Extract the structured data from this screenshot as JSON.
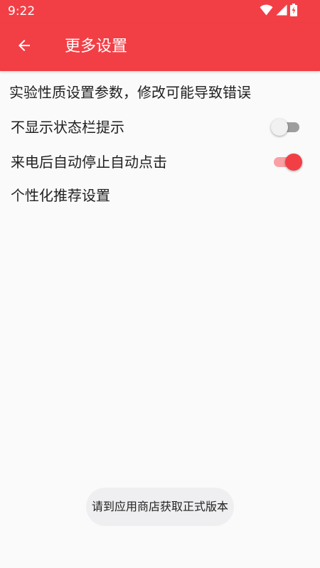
{
  "status_bar": {
    "time": "9:22",
    "icons": [
      "wifi-icon",
      "signal-icon",
      "battery-charging-icon"
    ]
  },
  "app_bar": {
    "title": "更多设置",
    "back_icon": "arrow-back-icon"
  },
  "warning": "实验性质设置参数，修改可能导致错误",
  "settings": [
    {
      "label": "不显示状态栏提示",
      "type": "switch",
      "checked": false
    },
    {
      "label": "来电后自动停止自动点击",
      "type": "switch",
      "checked": true
    },
    {
      "label": "个性化推荐设置",
      "type": "link"
    }
  ],
  "toast": "请到应用商店获取正式版本",
  "colors": {
    "primary": "#f23f46",
    "background": "#fafafa",
    "text": "#212121",
    "switch_track_on": "#f9a0a4",
    "switch_track_off": "#9e9e9e",
    "toast_background": "#efeff1"
  }
}
